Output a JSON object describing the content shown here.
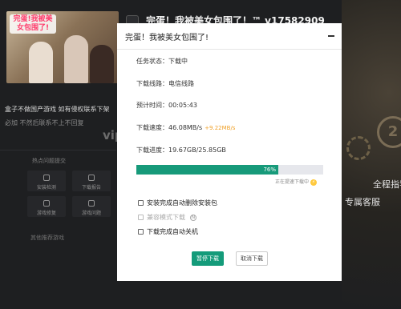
{
  "background": {
    "banner_logo": "完蛋!我被美女包围了!",
    "game_title": "完蛋！我被美女包围了！™ v17582909",
    "notice_line1": "盒子不做国产游戏 如有侵权联系下架",
    "notice_line2": "必加 不然后联系不上不回复",
    "vip_text": "vip",
    "hot_label": "热点问题提交",
    "cards": [
      "安装检测",
      "下载报告",
      "游戏修复",
      "游戏问题"
    ],
    "related_label": "其他推荐游戏",
    "quanz": "全程指导",
    "kefu": "专属客服"
  },
  "dialog": {
    "title": "完蛋！我被美女包围了!",
    "status_label": "任务状态：",
    "status_value": "下载中",
    "line_label": "下载线路：",
    "line_value": "电信线路",
    "eta_label": "预计时间：",
    "eta_value": "00:05:43",
    "speed_label": "下载速度：",
    "speed_value": "46.08MB/s",
    "speed_increase": "+9.22MB/s",
    "progress_label": "下载进度：",
    "progress_value": "19.67GB/25.85GB",
    "progress_percent": "76%",
    "progress_fraction": 0.76,
    "speedup_text": "正在提速下载中",
    "options": [
      {
        "label": "安装完成自动删除安装包",
        "checked": false,
        "enabled": true
      },
      {
        "label": "兼容模式下载",
        "checked": false,
        "enabled": false
      },
      {
        "label": "下载完成自动关机",
        "checked": false,
        "enabled": true
      }
    ],
    "pause_button": "暂停下载",
    "cancel_button": "取消下载"
  },
  "colors": {
    "accent": "#149b7a",
    "speed_increase": "#f0a22b"
  }
}
